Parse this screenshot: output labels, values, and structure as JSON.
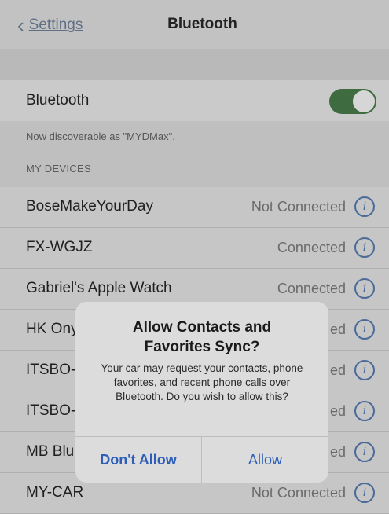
{
  "nav": {
    "back_label": "Settings",
    "title": "Bluetooth"
  },
  "bluetooth": {
    "label": "Bluetooth",
    "enabled": true,
    "toggle_color": "#3e6b3f"
  },
  "discoverable_note": "Now discoverable as \"MYDMax\".",
  "section_header": "MY DEVICES",
  "devices": [
    {
      "name": "BoseMakeYourDay",
      "status": "Not Connected"
    },
    {
      "name": "FX-WGJZ",
      "status": "Connected"
    },
    {
      "name": "Gabriel's Apple Watch",
      "status": "Connected"
    },
    {
      "name": "HK Ony",
      "status": "ed"
    },
    {
      "name": "ITSBO-",
      "status": "ed"
    },
    {
      "name": "ITSBO-",
      "status": "ed"
    },
    {
      "name": "MB Blu",
      "status": "ed"
    },
    {
      "name": "MY-CAR",
      "status": "Not Connected"
    }
  ],
  "alert": {
    "title": "Allow Contacts and Favorites Sync?",
    "message": "Your car may request your contacts, phone favorites, and recent phone calls over Bluetooth. Do you wish to allow this?",
    "deny_label": "Don't Allow",
    "allow_label": "Allow",
    "accent_color": "#2e5fb8"
  }
}
